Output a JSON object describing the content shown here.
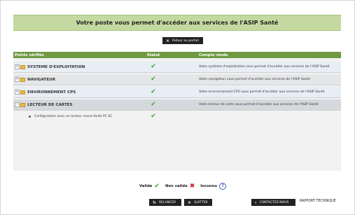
{
  "banner": {
    "title": "Votre poste vous permet d'accéder aux services de l'ASIP Santé"
  },
  "retour": {
    "icon": "×",
    "label": "Retour au portail"
  },
  "table": {
    "headers": {
      "points": "Points vérifiés",
      "statut": "Statut",
      "compte": "Compte rendu"
    },
    "groups": [
      {
        "name": "SYSTEME D'EXPLOITATION",
        "status": "✔",
        "desc": "Votre système d'exploitation vous permet d'accéder aux services de l'ASIP Santé"
      },
      {
        "name": "NAVIGATEUR",
        "status": "✔",
        "desc": "Votre navigateur vous permet d'accéder aux services de l'ASIP Santé"
      },
      {
        "name": "ENVIRONNEMENT CPS",
        "status": "✔",
        "desc": "Votre environnement CPS vous permet d'accéder aux services de l'ASIP Santé"
      },
      {
        "name": "LECTEUR DE CARTES",
        "status": "✔",
        "desc": "Votre lecteur de carte vous permet d'accéder aux services de l'ASIP Santé"
      }
    ],
    "sub": {
      "label": "Configuration avec un lecteur mono-fente PC SC",
      "status": "✔"
    }
  },
  "legend": {
    "valide": "Valide",
    "valide_mark": "✔",
    "non_valide": "Non valide",
    "non_valide_mark": "✖",
    "inconnu": "Inconnu",
    "inconnu_mark": "?"
  },
  "actions": {
    "relancer_icon": "↻",
    "relancer": "RELANCER",
    "quitter_icon": "×",
    "quitter": "QUITTER",
    "contact_icon": "›",
    "contact": "CONTACTEZ-NOUS",
    "rapport": "RAPPORT TECHNIQUE"
  },
  "colors": {
    "header_green": "#6f9a43",
    "banner_green": "#c4d9a0",
    "check_green": "#3fa536",
    "cross_red": "#c8202f"
  }
}
